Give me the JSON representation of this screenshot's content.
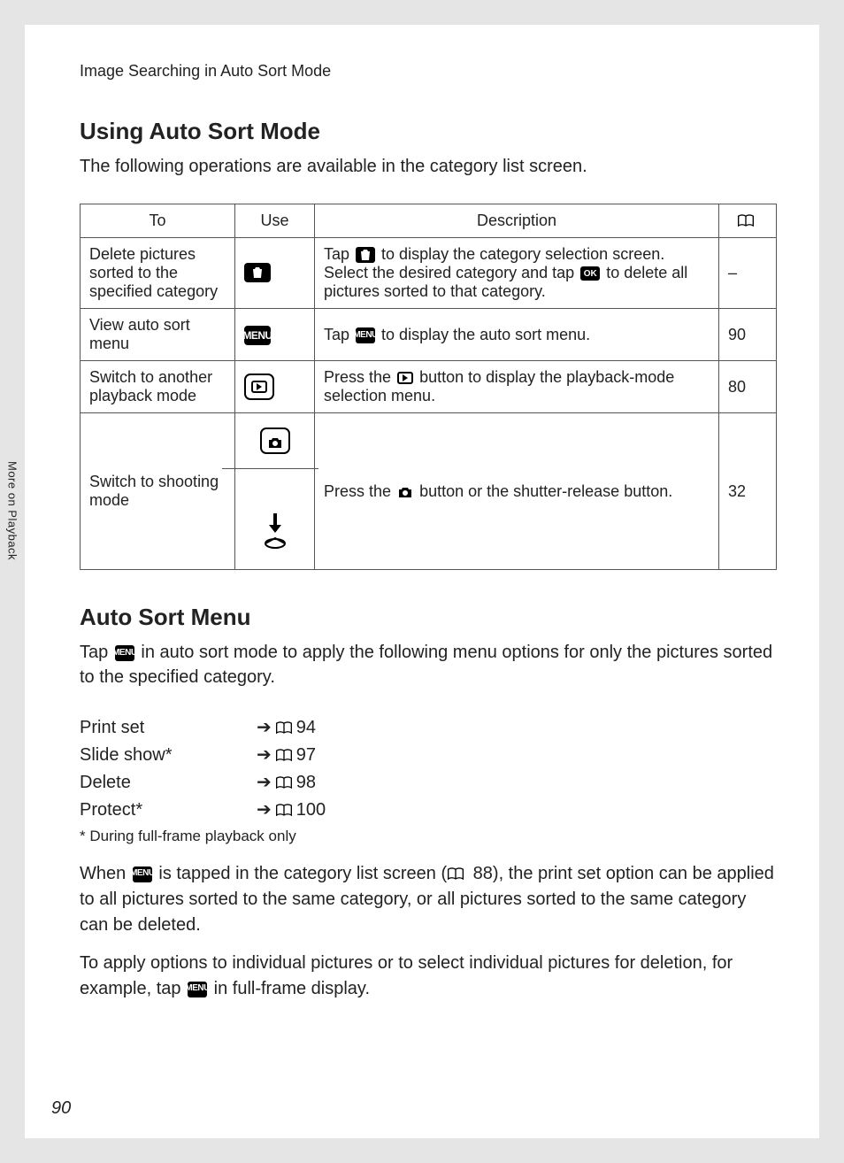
{
  "breadcrumb": "Image Searching in Auto Sort Mode",
  "section1": {
    "heading": "Using Auto Sort Mode",
    "intro": "The following operations are available in the category list screen.",
    "headers": {
      "to": "To",
      "use": "Use",
      "desc": "Description",
      "ref_icon": "book"
    },
    "rows": [
      {
        "to": "Delete pictures sorted to the specified category",
        "use_icon": "trash",
        "desc_pre": "Tap ",
        "desc_mid": " to display the category selection screen. Select the desired category and tap ",
        "desc_post": " to delete all pictures sorted to that category.",
        "ok_label": "OK",
        "ref": "–"
      },
      {
        "to": "View auto sort menu",
        "use_icon": "menu",
        "use_label": "MENU",
        "desc_pre": "Tap ",
        "desc_post": " to display the auto sort menu.",
        "ref": "90"
      },
      {
        "to": "Switch to another playback mode",
        "use_icon": "playback",
        "desc_pre": "Press the ",
        "desc_post": " button to display the playback-mode selection menu.",
        "ref": "80"
      },
      {
        "to": "Switch to shooting mode",
        "use_icons": [
          "camera",
          "shutter"
        ],
        "desc_pre": "Press the ",
        "desc_post": " button or the shutter-release button.",
        "ref": "32"
      }
    ]
  },
  "section2": {
    "heading": "Auto Sort Menu",
    "intro_pre": "Tap ",
    "intro_post": " in auto sort mode to apply the following menu options for only the pictures sorted to the specified category.",
    "menu_label": "MENU",
    "items": [
      {
        "label": "Print set",
        "page": "94"
      },
      {
        "label": "Slide show*",
        "page": "97"
      },
      {
        "label": "Delete",
        "page": "98"
      },
      {
        "label": "Protect*",
        "page": "100"
      }
    ],
    "footnote": "*  During full-frame playback only",
    "para1_pre": "When ",
    "para1_mid": " is tapped in the category list screen (",
    "para1_page": " 88), the print set option can be applied to all pictures sorted to the same category, or all pictures sorted to the same category can be deleted.",
    "para2_pre": "To apply options to individual pictures or to select individual pictures for deletion, for example, tap ",
    "para2_post": " in full-frame display."
  },
  "sidetab": "More on Playback",
  "page_number": "90"
}
